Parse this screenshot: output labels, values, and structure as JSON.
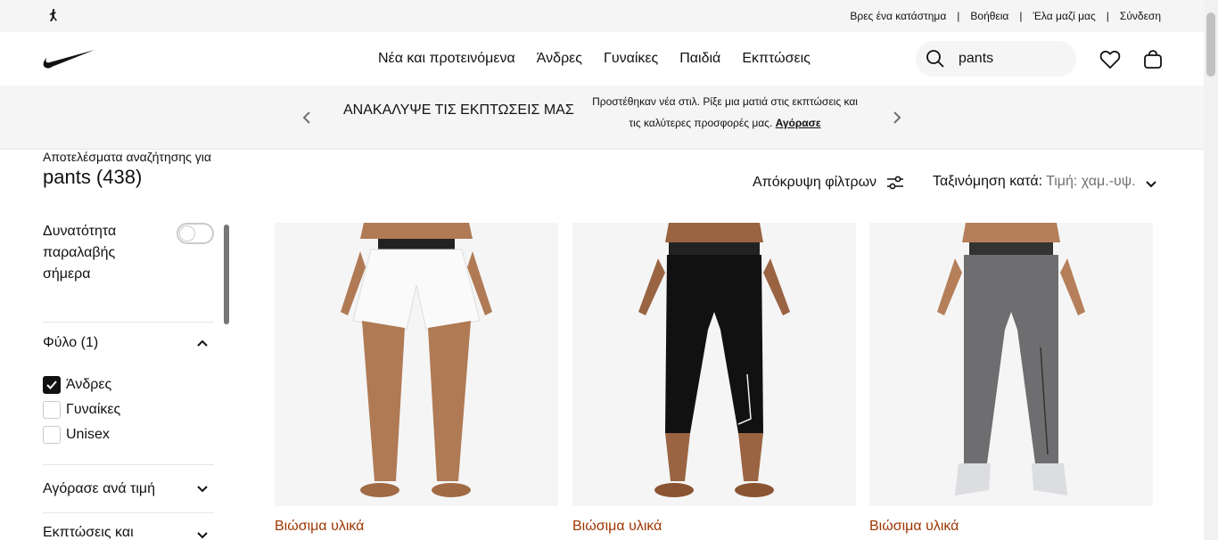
{
  "utility_bar": {
    "links": [
      "Βρες ένα κατάστημα",
      "Βοήθεια",
      "Έλα μαζί μας",
      "Σύνδεση"
    ],
    "separator": "|"
  },
  "nav": {
    "links": [
      "Νέα και προτεινόμενα",
      "Άνδρες",
      "Γυναίκες",
      "Παιδιά",
      "Εκπτώσεις"
    ],
    "search_value": "pants"
  },
  "promo": {
    "title": "ΑΝΑΚΑΛΥΨΕ ΤΙΣ ΕΚΠΤΩΣΕΙΣ ΜΑΣ",
    "text": "Προστέθηκαν νέα στιλ. Ρίξε μια ματιά στις εκπτώσεις και τις καλύτερες προσφορές μας.",
    "link": "Αγόρασε"
  },
  "results": {
    "caption": "Αποτελέσματα αναζήτησης για",
    "title": "pants (438)",
    "hide_filters": "Απόκρυψη φίλτρων",
    "sort_label": "Ταξινόμηση κατά:",
    "sort_value": "Τιμή: χαμ.-υψ."
  },
  "sidebar": {
    "pickup_label": "Δυνατότητα παραλαβής σήμερα",
    "pickup_enabled": false,
    "gender": {
      "title": "Φύλο (1)",
      "options": [
        {
          "label": "Άνδρες",
          "checked": true
        },
        {
          "label": "Γυναίκες",
          "checked": false
        },
        {
          "label": "Unisex",
          "checked": false
        }
      ]
    },
    "price_title": "Αγόρασε ανά τιμή",
    "sale_title": "Εκπτώσεις και"
  },
  "products": [
    {
      "badge": "Βιώσιμα υλικά",
      "color": "white"
    },
    {
      "badge": "Βιώσιμα υλικά",
      "color": "black"
    },
    {
      "badge": "Βιώσιμα υλικά",
      "color": "grey"
    }
  ],
  "colors": {
    "badge": "#9e3500",
    "muted": "#707072",
    "background_light": "#f5f5f5"
  }
}
